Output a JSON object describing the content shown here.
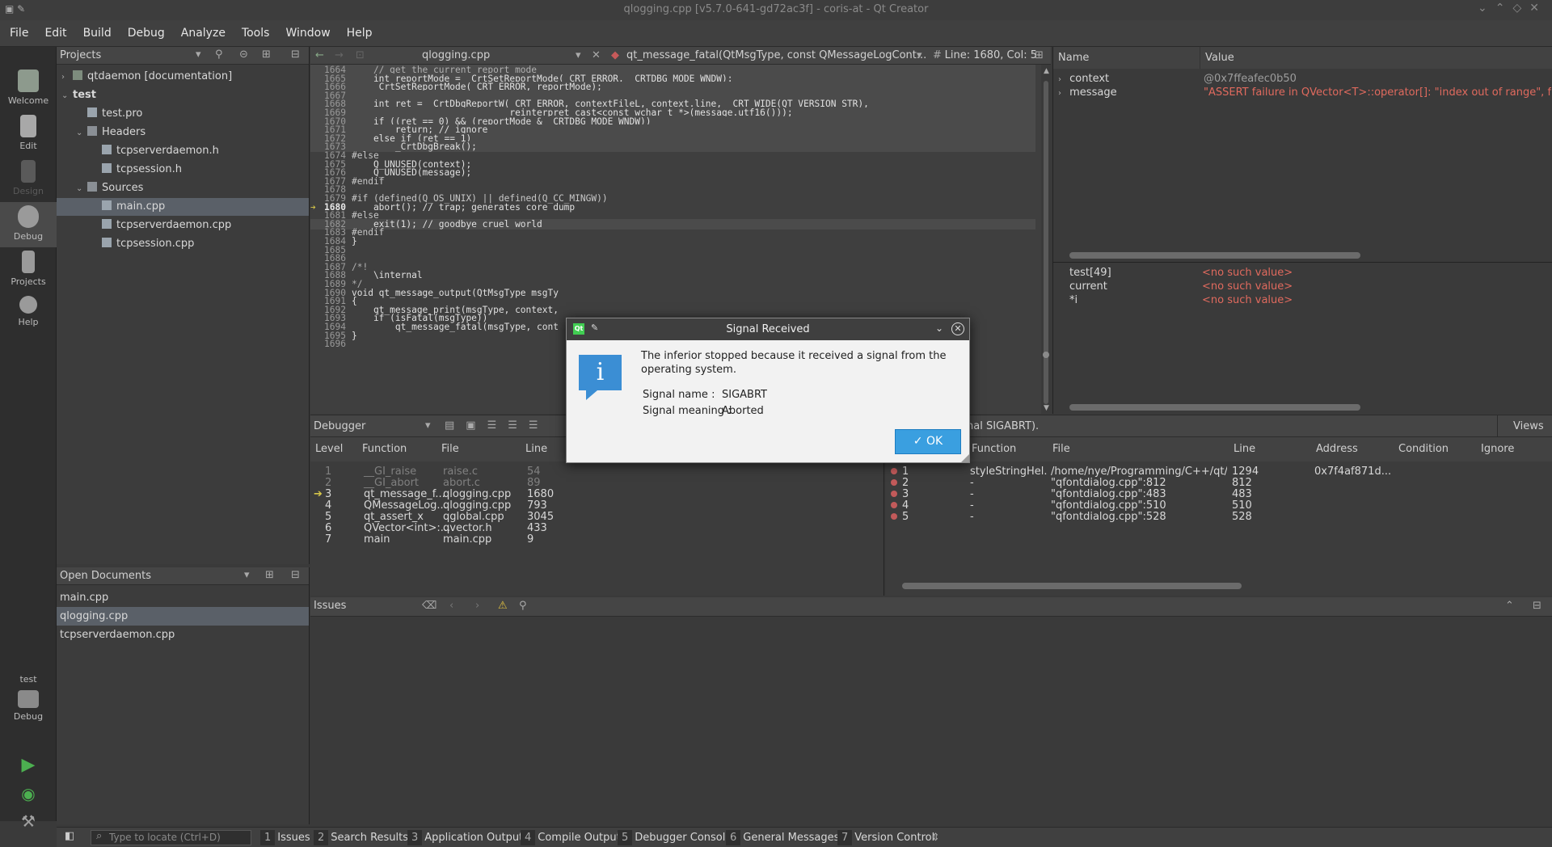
{
  "window": {
    "title": "qlogging.cpp [v5.7.0-641-gd72ac3f] - coris-at - Qt Creator"
  },
  "menubar": [
    "File",
    "Edit",
    "Build",
    "Debug",
    "Analyze",
    "Tools",
    "Window",
    "Help"
  ],
  "modes": [
    {
      "label": "Welcome",
      "icon": "qt-logo-icon"
    },
    {
      "label": "Edit",
      "icon": "document-edit-icon"
    },
    {
      "label": "Design",
      "icon": "pencil-icon"
    },
    {
      "label": "Debug",
      "icon": "bug-icon"
    },
    {
      "label": "Projects",
      "icon": "projects-icon"
    },
    {
      "label": "Help",
      "icon": "help-icon"
    }
  ],
  "target": {
    "project": "test",
    "config": "Debug"
  },
  "projects": {
    "header": "Projects",
    "tree": [
      {
        "label": "qtdaemon [documentation]",
        "depth": 0,
        "arrow": "right",
        "icon": "project"
      },
      {
        "label": "test",
        "depth": 0,
        "arrow": "down",
        "icon": "none"
      },
      {
        "label": "test.pro",
        "depth": 1,
        "arrow": "",
        "icon": "file"
      },
      {
        "label": "Headers",
        "depth": 1,
        "arrow": "down",
        "icon": "folder"
      },
      {
        "label": "tcpserverdaemon.h",
        "depth": 2,
        "arrow": "",
        "icon": "header"
      },
      {
        "label": "tcpsession.h",
        "depth": 2,
        "arrow": "",
        "icon": "header"
      },
      {
        "label": "Sources",
        "depth": 1,
        "arrow": "down",
        "icon": "folder"
      },
      {
        "label": "main.cpp",
        "depth": 2,
        "arrow": "",
        "icon": "source",
        "selected": true
      },
      {
        "label": "tcpserverdaemon.cpp",
        "depth": 2,
        "arrow": "",
        "icon": "source"
      },
      {
        "label": "tcpsession.cpp",
        "depth": 2,
        "arrow": "",
        "icon": "source"
      }
    ]
  },
  "open_documents": {
    "header": "Open Documents",
    "items": [
      "main.cpp",
      "qlogging.cpp",
      "tcpserverdaemon.cpp"
    ],
    "selected_index": 1
  },
  "editor": {
    "file": "qlogging.cpp",
    "symbol": "qt_message_fatal(QtMsgType, const QMessageLogCont...",
    "hash": "#",
    "position": "Line: 1680, Col: 5",
    "current_line": "1680",
    "lines": [
      {
        "n": "1664",
        "t": "    // get the current report mode"
      },
      {
        "n": "1665",
        "t": "    int reportMode = _CrtSetReportMode(_CRT_ERROR, _CRTDBG_MODE_WNDW);"
      },
      {
        "n": "1666",
        "t": "    _CrtSetReportMode(_CRT_ERROR, reportMode);"
      },
      {
        "n": "1667",
        "t": ""
      },
      {
        "n": "1668",
        "t": "    int ret = _CrtDbgReportW(_CRT_ERROR, contextFileL, context.line, _CRT_WIDE(QT_VERSION_STR),"
      },
      {
        "n": "1669",
        "t": "                             reinterpret_cast<const wchar_t *>(message.utf16()));"
      },
      {
        "n": "1670",
        "t": "    if ((ret == 0) && (reportMode & _CRTDBG_MODE_WNDW))"
      },
      {
        "n": "1671",
        "t": "        return; // ignore"
      },
      {
        "n": "1672",
        "t": "    else if (ret == 1)"
      },
      {
        "n": "1673",
        "t": "        _CrtDbgBreak();"
      },
      {
        "n": "1674",
        "t": "#else"
      },
      {
        "n": "1675",
        "t": "    Q_UNUSED(context);"
      },
      {
        "n": "1676",
        "t": "    Q_UNUSED(message);"
      },
      {
        "n": "1677",
        "t": "#endif"
      },
      {
        "n": "1678",
        "t": ""
      },
      {
        "n": "1679",
        "t": "#if (defined(Q_OS_UNIX) || defined(Q_CC_MINGW))"
      },
      {
        "n": "1680",
        "t": "    abort(); // trap; generates core dump"
      },
      {
        "n": "1681",
        "t": "#else"
      },
      {
        "n": "1682",
        "t": "    exit(1); // goodbye cruel world"
      },
      {
        "n": "1683",
        "t": "#endif"
      },
      {
        "n": "1684",
        "t": "}"
      },
      {
        "n": "1685",
        "t": ""
      },
      {
        "n": "1686",
        "t": ""
      },
      {
        "n": "1687",
        "t": "/*!"
      },
      {
        "n": "1688",
        "t": "    \\internal"
      },
      {
        "n": "1689",
        "t": "*/"
      },
      {
        "n": "1690",
        "t": "void qt_message_output(QtMsgType msgTy"
      },
      {
        "n": "1691",
        "t": "{"
      },
      {
        "n": "1692",
        "t": "    qt_message_print(msgType, context,"
      },
      {
        "n": "1693",
        "t": "    if (isFatal(msgType))"
      },
      {
        "n": "1694",
        "t": "        qt_message_fatal(msgType, cont"
      },
      {
        "n": "1695",
        "t": "}"
      },
      {
        "n": "1696",
        "t": ""
      }
    ]
  },
  "locals": {
    "headers": [
      "Name",
      "Value"
    ],
    "rows": [
      {
        "name": "context",
        "value": "@0x7ffeafec0b50"
      },
      {
        "name": "message",
        "value": "\"ASSERT failure in QVector<T>::operator[]: \"index out of range\", file /home/r"
      }
    ],
    "expressions": [
      {
        "name": "test[49]",
        "value": "<no such value>"
      },
      {
        "name": "current",
        "value": "<no such value>"
      },
      {
        "name": "*i",
        "value": "<no such value>"
      }
    ]
  },
  "debugger_bar": {
    "label": "Debugger",
    "status": "nal SIGABRT).",
    "views": "Views"
  },
  "stack": {
    "headers": [
      "Level",
      "Function",
      "File",
      "Line"
    ],
    "rows": [
      {
        "level": "1",
        "func": "__GI_raise",
        "file": "raise.c",
        "line": "54",
        "dim": true
      },
      {
        "level": "2",
        "func": "__GI_abort",
        "file": "abort.c",
        "line": "89",
        "dim": true
      },
      {
        "level": "3",
        "func": "qt_message_f...",
        "file": "qlogging.cpp",
        "line": "1680",
        "current": true
      },
      {
        "level": "4",
        "func": "QMessageLog...",
        "file": "qlogging.cpp",
        "line": "793"
      },
      {
        "level": "5",
        "func": "qt_assert_x",
        "file": "qglobal.cpp",
        "line": "3045"
      },
      {
        "level": "6",
        "func": "QVector<int>:...",
        "file": "qvector.h",
        "line": "433"
      },
      {
        "level": "7",
        "func": "main",
        "file": "main.cpp",
        "line": "9"
      }
    ]
  },
  "breakpoints": {
    "headers": [
      "Function",
      "File",
      "Line",
      "Address",
      "Condition",
      "Ignore"
    ],
    "rows": [
      {
        "num": "1",
        "func": "styleStringHel...",
        "file": "/home/nye/Programming/C++/qt/...",
        "line": "1294",
        "addr": "0x7f4af871d..."
      },
      {
        "num": "2",
        "func": "-",
        "file": "\"qfontdialog.cpp\":812",
        "line": "812",
        "addr": ""
      },
      {
        "num": "3",
        "func": "-",
        "file": "\"qfontdialog.cpp\":483",
        "line": "483",
        "addr": ""
      },
      {
        "num": "4",
        "func": "-",
        "file": "\"qfontdialog.cpp\":510",
        "line": "510",
        "addr": ""
      },
      {
        "num": "5",
        "func": "-",
        "file": "\"qfontdialog.cpp\":528",
        "line": "528",
        "addr": ""
      }
    ]
  },
  "issues": {
    "header": "Issues"
  },
  "statusbar": {
    "locate_placeholder": "Type to locate (Ctrl+D)",
    "panes": [
      {
        "num": "1",
        "label": "Issues"
      },
      {
        "num": "2",
        "label": "Search Results"
      },
      {
        "num": "3",
        "label": "Application Output"
      },
      {
        "num": "4",
        "label": "Compile Output"
      },
      {
        "num": "5",
        "label": "Debugger Console"
      },
      {
        "num": "6",
        "label": "General Messages"
      },
      {
        "num": "7",
        "label": "Version Control"
      }
    ]
  },
  "dialog": {
    "title": "Signal Received",
    "message": "The inferior stopped because it received a signal from the operating system.",
    "signal_name_label": "Signal name :",
    "signal_name": "SIGABRT",
    "signal_meaning_label": "Signal meaning :",
    "signal_meaning": "Aborted",
    "ok_label": "OK",
    "icon": "information-icon"
  },
  "colors": {
    "accent": "#3a9fe0",
    "value_red": "#e06a5e",
    "breakpoint": "#c25a5a",
    "current_arrow": "#d6c64a"
  }
}
